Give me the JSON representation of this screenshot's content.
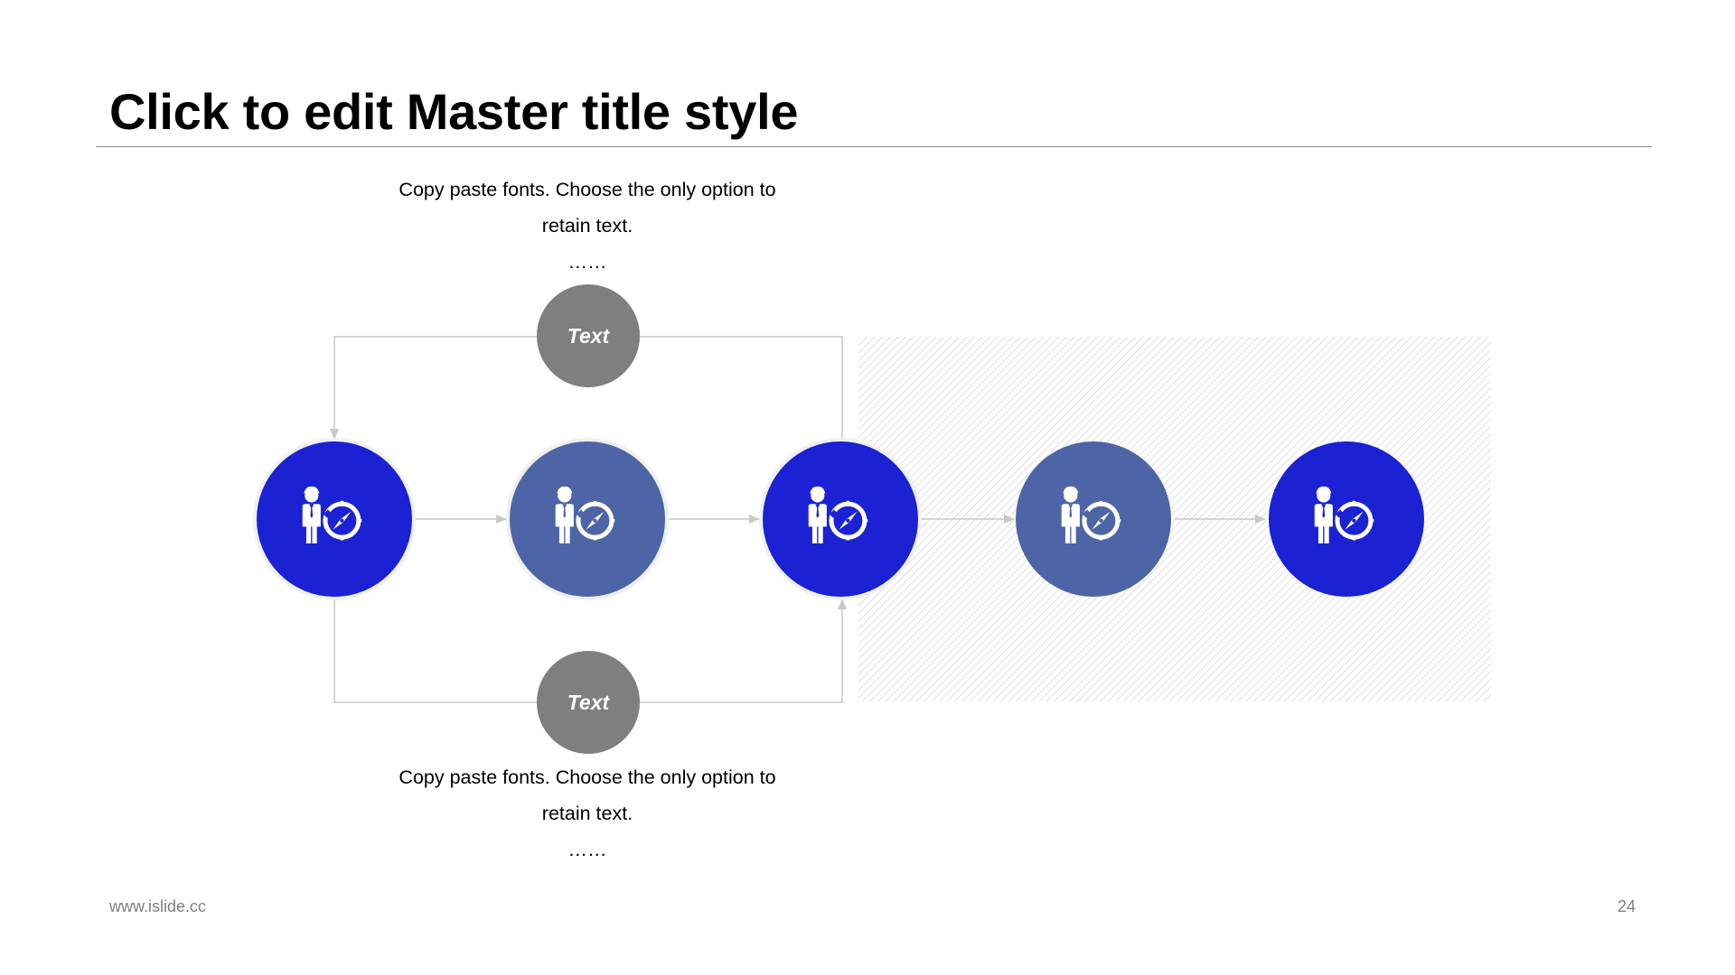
{
  "slide": {
    "title": "Click to edit Master title style",
    "footer_url": "www.islide.cc",
    "page_number": "24"
  },
  "captions": {
    "top": {
      "line1": "Copy paste fonts. Choose the only option to",
      "line2": "retain text.",
      "ellipsis": "……"
    },
    "bottom": {
      "line1": "Copy paste fonts. Choose the only option to",
      "line2": "retain text.",
      "ellipsis": "……"
    }
  },
  "diagram": {
    "branch_nodes": [
      {
        "label": "Text",
        "position": "top"
      },
      {
        "label": "Text",
        "position": "bottom"
      }
    ],
    "main_nodes": [
      {
        "icon": "businessman-compass-icon",
        "color": "#1a22d4"
      },
      {
        "icon": "businessman-compass-icon",
        "color": "#4d65a6"
      },
      {
        "icon": "businessman-compass-icon",
        "color": "#1a22d4"
      },
      {
        "icon": "businessman-compass-icon",
        "color": "#4d65a6"
      },
      {
        "icon": "businessman-compass-icon",
        "color": "#1a22d4"
      }
    ]
  },
  "colors": {
    "primary_blue": "#1a22d4",
    "secondary_blue": "#4d65a6",
    "branch_gray": "#7f7f7f",
    "connector_gray": "#c8c8c8",
    "hatch_gray": "#d0d0d0"
  }
}
